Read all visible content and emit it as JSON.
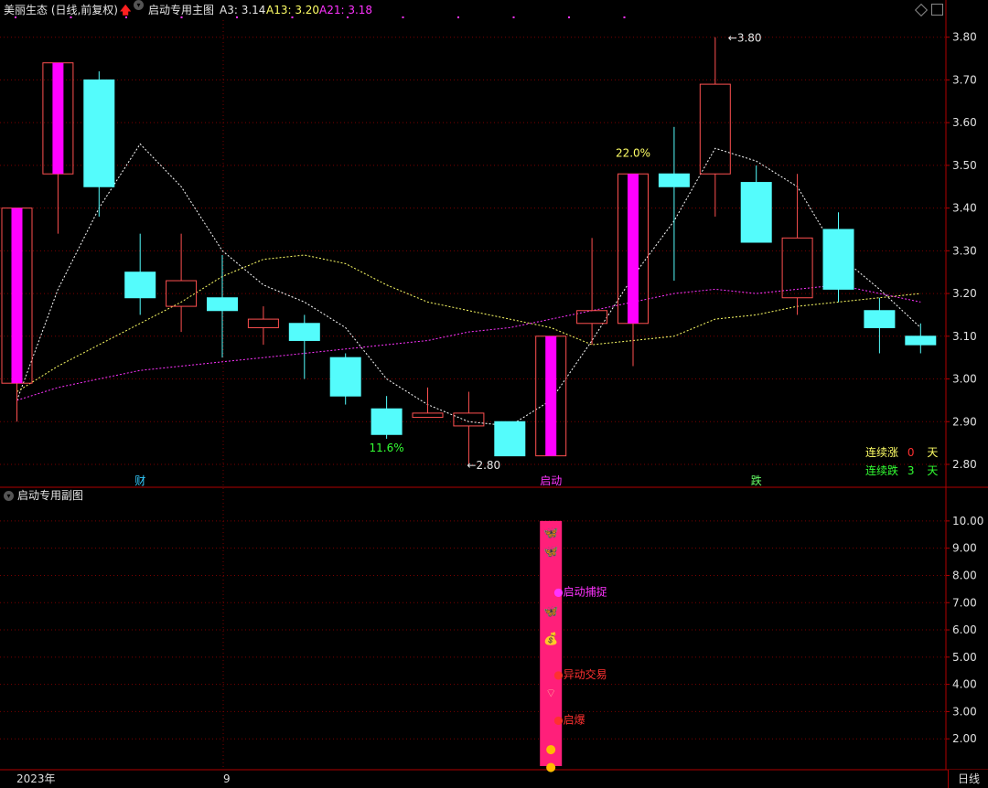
{
  "header": {
    "stock_title": "美丽生态 (日线,前复权)",
    "indicator_name": "启动专用主图",
    "a3_label": "A3: 3.14",
    "a13_label": "A13: 3.20",
    "a21_label": "A21: 3.18"
  },
  "sub_header": {
    "indicator_name": "启动专用副图"
  },
  "colors": {
    "up": "#ff5050",
    "down": "#54fcfc",
    "bigup": "#ff00ff",
    "a3": "#ffffff",
    "a13": "#ffff66",
    "a21": "#ff33ff",
    "grid": "#7a0000",
    "subbar": "#ff1f7a"
  },
  "chart_data": {
    "type": "candlestick",
    "main_ylim": [
      2.77,
      3.84
    ],
    "main_ticks": [
      "3.80",
      "3.70",
      "3.60",
      "3.50",
      "3.40",
      "3.30",
      "3.20",
      "3.10",
      "3.00",
      "2.90",
      "2.80"
    ],
    "candles": [
      {
        "o": 2.99,
        "c": 3.4,
        "h": 3.4,
        "l": 2.9,
        "style": "bigup"
      },
      {
        "o": 3.48,
        "c": 3.74,
        "h": 3.74,
        "l": 3.34,
        "style": "bigup"
      },
      {
        "o": 3.7,
        "c": 3.45,
        "h": 3.72,
        "l": 3.38,
        "style": "down"
      },
      {
        "o": 3.25,
        "c": 3.19,
        "h": 3.34,
        "l": 3.15,
        "style": "down"
      },
      {
        "o": 3.17,
        "c": 3.23,
        "h": 3.34,
        "l": 3.11,
        "style": "up"
      },
      {
        "o": 3.19,
        "c": 3.16,
        "h": 3.29,
        "l": 3.05,
        "style": "down"
      },
      {
        "o": 3.12,
        "c": 3.14,
        "h": 3.17,
        "l": 3.08,
        "style": "up"
      },
      {
        "o": 3.13,
        "c": 3.09,
        "h": 3.15,
        "l": 3.0,
        "style": "down"
      },
      {
        "o": 3.05,
        "c": 2.96,
        "h": 3.06,
        "l": 2.94,
        "style": "down"
      },
      {
        "o": 2.93,
        "c": 2.87,
        "h": 2.96,
        "l": 2.86,
        "style": "down"
      },
      {
        "o": 2.91,
        "c": 2.92,
        "h": 2.98,
        "l": 2.91,
        "style": "up"
      },
      {
        "o": 2.89,
        "c": 2.92,
        "h": 2.97,
        "l": 2.8,
        "style": "up"
      },
      {
        "o": 2.9,
        "c": 2.82,
        "h": 2.9,
        "l": 2.82,
        "style": "down"
      },
      {
        "o": 2.82,
        "c": 3.1,
        "h": 3.1,
        "l": 2.82,
        "style": "bigup"
      },
      {
        "o": 3.13,
        "c": 3.16,
        "h": 3.33,
        "l": 3.08,
        "style": "up"
      },
      {
        "o": 3.13,
        "c": 3.48,
        "h": 3.48,
        "l": 3.03,
        "style": "bigup"
      },
      {
        "o": 3.48,
        "c": 3.45,
        "h": 3.59,
        "l": 3.23,
        "style": "down"
      },
      {
        "o": 3.48,
        "c": 3.69,
        "h": 3.8,
        "l": 3.38,
        "style": "up"
      },
      {
        "o": 3.46,
        "c": 3.32,
        "h": 3.5,
        "l": 3.32,
        "style": "down"
      },
      {
        "o": 3.19,
        "c": 3.33,
        "h": 3.48,
        "l": 3.15,
        "style": "up"
      },
      {
        "o": 3.35,
        "c": 3.21,
        "h": 3.39,
        "l": 3.18,
        "style": "down"
      },
      {
        "o": 3.16,
        "c": 3.12,
        "h": 3.19,
        "l": 3.06,
        "style": "down"
      },
      {
        "o": 3.1,
        "c": 3.08,
        "h": 3.13,
        "l": 3.06,
        "style": "down"
      }
    ],
    "series": [
      {
        "name": "A3",
        "values": [
          2.95,
          3.21,
          3.4,
          3.55,
          3.45,
          3.3,
          3.22,
          3.18,
          3.12,
          3.0,
          2.94,
          2.9,
          2.89,
          2.95,
          3.09,
          3.24,
          3.37,
          3.54,
          3.51,
          3.45,
          3.29,
          3.21,
          3.12
        ]
      },
      {
        "name": "A13",
        "values": [
          2.97,
          3.03,
          3.08,
          3.13,
          3.18,
          3.24,
          3.28,
          3.29,
          3.27,
          3.22,
          3.18,
          3.16,
          3.14,
          3.12,
          3.08,
          3.09,
          3.1,
          3.14,
          3.15,
          3.17,
          3.18,
          3.19,
          3.2
        ]
      },
      {
        "name": "A21",
        "values": [
          2.95,
          2.98,
          3.0,
          3.02,
          3.03,
          3.04,
          3.05,
          3.06,
          3.07,
          3.08,
          3.09,
          3.11,
          3.12,
          3.14,
          3.16,
          3.18,
          3.2,
          3.21,
          3.2,
          3.21,
          3.22,
          3.2,
          3.18
        ]
      }
    ],
    "annotations": [
      {
        "text": "3.80",
        "at": 17,
        "price": 3.8,
        "kind": "high"
      },
      {
        "text": "2.80",
        "at": 11,
        "price": 2.8,
        "kind": "low"
      },
      {
        "text": "22.0%",
        "at": 15,
        "price": 3.52,
        "kind": "pct",
        "color": "#ffff66"
      },
      {
        "text": "11.6%",
        "at": 9,
        "price": 2.83,
        "kind": "pct",
        "color": "#33ff33"
      }
    ],
    "bottom_markers": [
      {
        "text": "财",
        "at": 3,
        "color": "#33ccff"
      },
      {
        "text": "启动",
        "at": 13,
        "color": "#ff33ff"
      },
      {
        "text": "跌",
        "at": 18,
        "color": "#66ff66"
      }
    ],
    "sub_ylim": [
      1.0,
      10.6
    ],
    "sub_ticks": [
      "10.00",
      "9.00",
      "8.00",
      "7.00",
      "6.00",
      "5.00",
      "4.00",
      "3.00",
      "2.00"
    ],
    "sub_bar": {
      "at": 13,
      "from": 1.0,
      "to": 10.0
    },
    "sub_labels": [
      {
        "text": "启动捕捉",
        "value": 7.4,
        "color": "#ff33ff"
      },
      {
        "text": "异动交易",
        "value": 4.35,
        "color": "#ff3030"
      },
      {
        "text": "启爆",
        "value": 2.7,
        "color": "#ff3030"
      }
    ],
    "sub_icons": [
      {
        "icon": "butterfly-icon",
        "value": 9.6
      },
      {
        "icon": "butterfly-icon",
        "value": 8.9
      },
      {
        "icon": "butterfly-icon",
        "value": 6.7
      },
      {
        "icon": "money-bag-icon",
        "value": 5.7
      },
      {
        "icon": "fan-icon",
        "value": 3.7
      },
      {
        "icon": "peach-icon",
        "value": 1.65
      },
      {
        "icon": "peach-icon",
        "value": 1.0
      }
    ]
  },
  "stats": {
    "rise_label": "连续涨",
    "rise_count": "0",
    "fall_label": "连续跌",
    "fall_count": "3",
    "day_unit": "天"
  },
  "footer": {
    "year_label": "2023年",
    "month_label": "9",
    "period_button": "日线"
  }
}
